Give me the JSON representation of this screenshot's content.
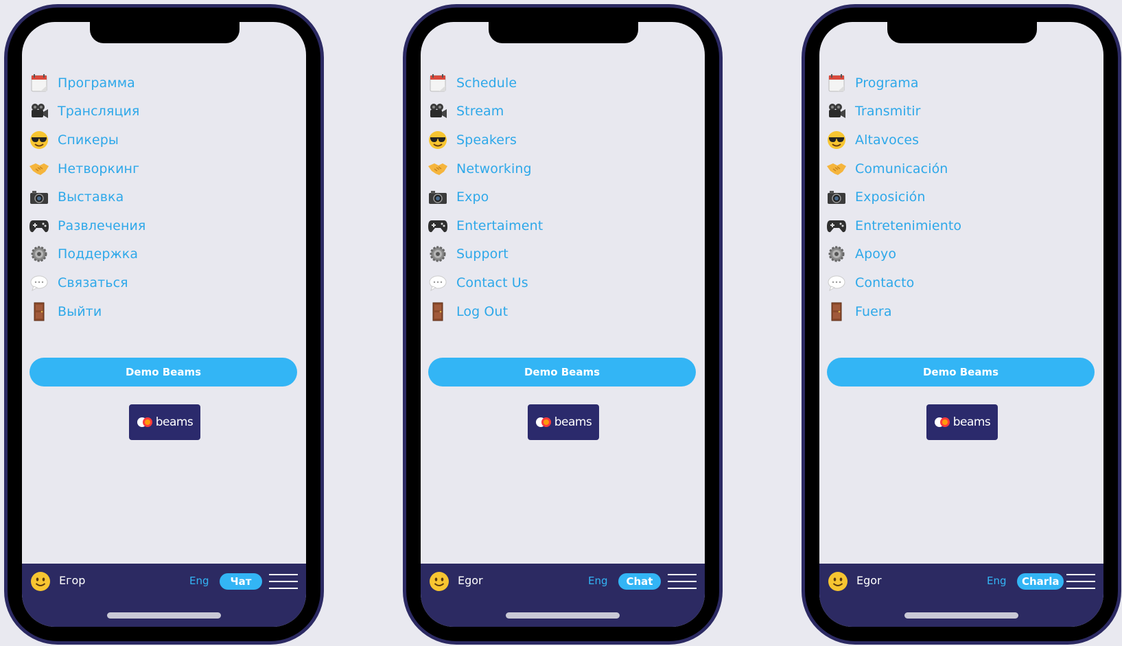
{
  "phones": [
    {
      "menu": [
        {
          "label": "Программа",
          "icon": "calendar-icon"
        },
        {
          "label": "Трансляция",
          "icon": "video-camera-icon"
        },
        {
          "label": "Спикеры",
          "icon": "sunglasses-face-icon"
        },
        {
          "label": "Нетворкинг",
          "icon": "handshake-icon"
        },
        {
          "label": "Выставка",
          "icon": "camera-icon"
        },
        {
          "label": "Развлечения",
          "icon": "gamepad-icon"
        },
        {
          "label": "Поддержка",
          "icon": "gear-icon"
        },
        {
          "label": "Связаться",
          "icon": "speech-bubble-icon"
        },
        {
          "label": "Выйти",
          "icon": "door-icon"
        }
      ],
      "demo_button": "Demo Beams",
      "logo_text": "beams",
      "user_name": "Егор",
      "lang": "Eng",
      "chat": "Чат"
    },
    {
      "menu": [
        {
          "label": "Schedule",
          "icon": "calendar-icon"
        },
        {
          "label": "Stream",
          "icon": "video-camera-icon"
        },
        {
          "label": "Speakers",
          "icon": "sunglasses-face-icon"
        },
        {
          "label": "Networking",
          "icon": "handshake-icon"
        },
        {
          "label": "Expo",
          "icon": "camera-icon"
        },
        {
          "label": "Entertaiment",
          "icon": "gamepad-icon"
        },
        {
          "label": "Support",
          "icon": "gear-icon"
        },
        {
          "label": "Contact Us",
          "icon": "speech-bubble-icon"
        },
        {
          "label": "Log Out",
          "icon": "door-icon"
        }
      ],
      "demo_button": "Demo Beams",
      "logo_text": "beams",
      "user_name": "Egor",
      "lang": "Eng",
      "chat": "Chat"
    },
    {
      "menu": [
        {
          "label": "Programa",
          "icon": "calendar-icon"
        },
        {
          "label": "Transmitir",
          "icon": "video-camera-icon"
        },
        {
          "label": "Altavoces",
          "icon": "sunglasses-face-icon"
        },
        {
          "label": "Comunicación",
          "icon": "handshake-icon"
        },
        {
          "label": "Exposición",
          "icon": "camera-icon"
        },
        {
          "label": "Entretenimiento",
          "icon": "gamepad-icon"
        },
        {
          "label": "Apoyo",
          "icon": "gear-icon"
        },
        {
          "label": "Contacto",
          "icon": "speech-bubble-icon"
        },
        {
          "label": "Fuera",
          "icon": "door-icon"
        }
      ],
      "demo_button": "Demo Beams",
      "logo_text": "beams",
      "user_name": "Egor",
      "lang": "Eng",
      "chat": "Charla"
    }
  ],
  "colors": {
    "accent": "#33b5f5",
    "link": "#2ea8e9",
    "bar": "#2c2a62",
    "logo_bg": "#2b2a6c",
    "screen_bg": "#e8e8ef"
  }
}
